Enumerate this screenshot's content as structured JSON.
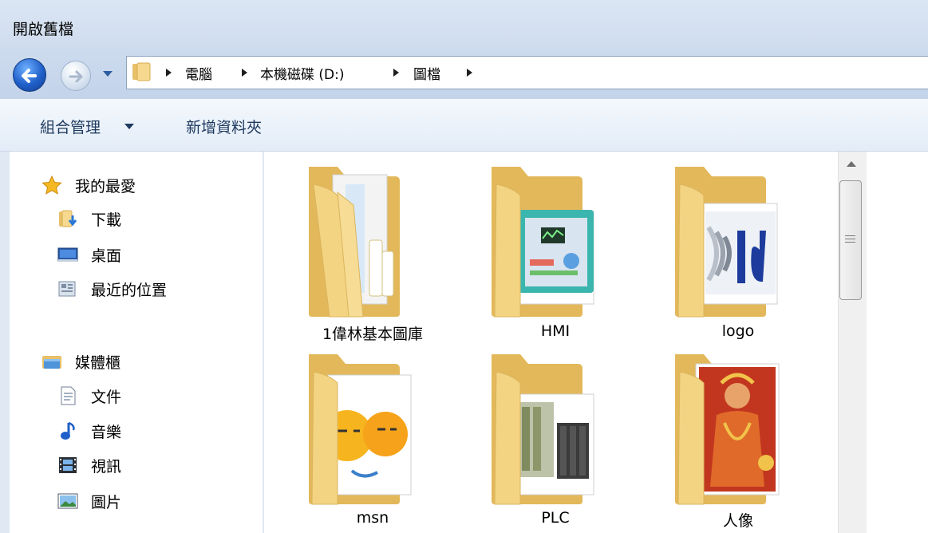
{
  "window": {
    "title": "開啟舊檔"
  },
  "address": {
    "crumbs": [
      "電腦",
      "本機磁碟 (D:)",
      "圖檔"
    ]
  },
  "toolbar": {
    "organize_label": "組合管理",
    "new_folder_label": "新增資料夾"
  },
  "nav": {
    "favorites": {
      "label": "我的最愛",
      "items": [
        "下載",
        "桌面",
        "最近的位置"
      ]
    },
    "libraries": {
      "label": "媒體櫃",
      "items": [
        "文件",
        "音樂",
        "視訊",
        "圖片"
      ]
    }
  },
  "folders": [
    {
      "name": "1偉林基本圖庫",
      "preview": "documents"
    },
    {
      "name": "HMI",
      "preview": "hmi-panel"
    },
    {
      "name": "logo",
      "preview": "logo-image"
    },
    {
      "name": "msn",
      "preview": "emoji-faces"
    },
    {
      "name": "PLC",
      "preview": "plc-modules"
    },
    {
      "name": "人像",
      "preview": "portrait-art"
    }
  ],
  "colors": {
    "folder": "#f3d483",
    "folder_dark": "#e3b85a",
    "accent_blue": "#1f5fc9"
  }
}
